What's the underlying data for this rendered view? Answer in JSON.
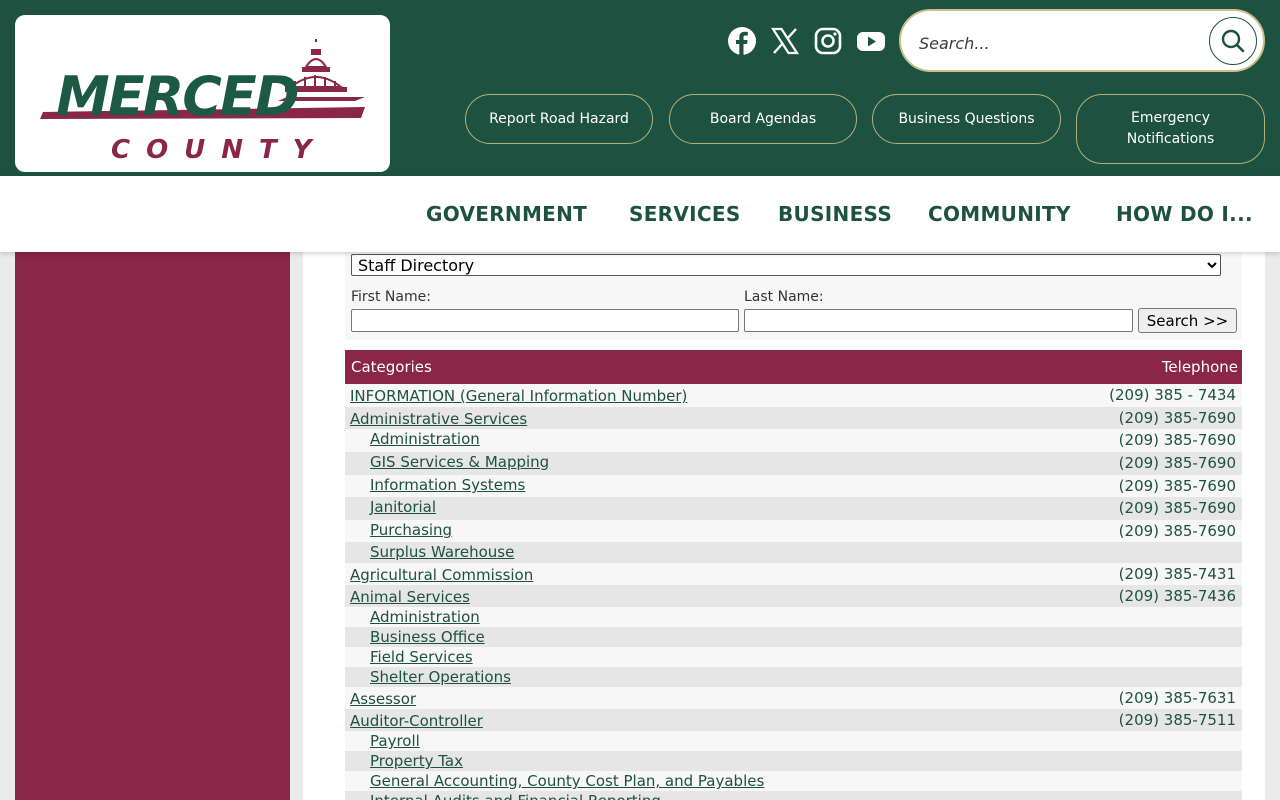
{
  "header": {
    "logo_main": "MERCED",
    "logo_sub": "COUNTY",
    "social": [
      "facebook-icon",
      "x-icon",
      "instagram-icon",
      "youtube-icon"
    ],
    "search_placeholder": "Search...",
    "quick_links": [
      "Report Road Hazard",
      "Board Agendas",
      "Business Questions",
      "Emergency Notifications"
    ]
  },
  "nav": {
    "items": [
      "GOVERNMENT",
      "SERVICES",
      "BUSINESS",
      "COMMUNITY",
      "HOW DO I..."
    ]
  },
  "form": {
    "directory_selected": "Staff Directory",
    "first_name_label": "First Name:",
    "last_name_label": "Last Name:",
    "first_name_value": "",
    "last_name_value": "",
    "search_label": "Search >>"
  },
  "table": {
    "col_categories": "Categories",
    "col_telephone": "Telephone",
    "rows": [
      {
        "name": "INFORMATION (General Information Number)",
        "tel": "(209) 385 - 7434",
        "sub": false
      },
      {
        "name": "Administrative Services",
        "tel": "(209) 385-7690",
        "sub": false
      },
      {
        "name": "Administration",
        "tel": "(209) 385-7690",
        "sub": true
      },
      {
        "name": "GIS Services & Mapping",
        "tel": "(209) 385-7690",
        "sub": true
      },
      {
        "name": "Information Systems",
        "tel": "(209) 385-7690",
        "sub": true
      },
      {
        "name": "Janitorial",
        "tel": "(209) 385-7690",
        "sub": true
      },
      {
        "name": "Purchasing",
        "tel": "(209) 385-7690",
        "sub": true
      },
      {
        "name": "Surplus Warehouse",
        "tel": "",
        "sub": true
      },
      {
        "name": "Agricultural Commission",
        "tel": "(209) 385-7431",
        "sub": false
      },
      {
        "name": "Animal Services",
        "tel": "(209) 385-7436",
        "sub": false
      },
      {
        "name": "Administration",
        "tel": "",
        "sub": true
      },
      {
        "name": "Business Office",
        "tel": "",
        "sub": true
      },
      {
        "name": "Field Services",
        "tel": "",
        "sub": true
      },
      {
        "name": "Shelter Operations",
        "tel": "",
        "sub": true
      },
      {
        "name": "Assessor",
        "tel": "(209) 385-7631",
        "sub": false
      },
      {
        "name": "Auditor-Controller",
        "tel": "(209) 385-7511",
        "sub": false
      },
      {
        "name": "Payroll",
        "tel": "",
        "sub": true
      },
      {
        "name": "Property Tax",
        "tel": "",
        "sub": true
      },
      {
        "name": "General Accounting, County Cost Plan, and Payables",
        "tel": "",
        "sub": true
      },
      {
        "name": "Internal Audits and Financial Reporting",
        "tel": "",
        "sub": true
      }
    ]
  },
  "colors": {
    "brand_green": "#1d5140",
    "brand_maroon": "#8a2647"
  }
}
